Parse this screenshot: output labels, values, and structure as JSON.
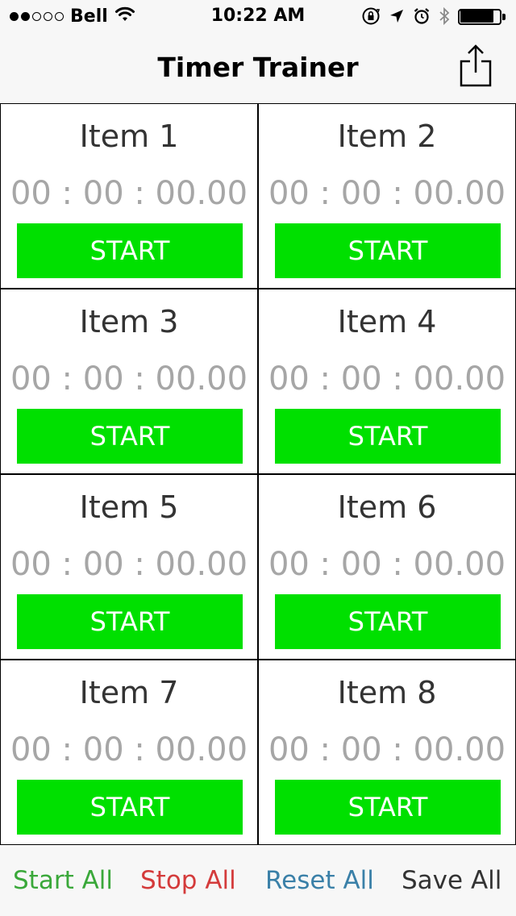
{
  "status_bar": {
    "carrier": "Bell",
    "time": "10:22 AM",
    "signal_bars_filled": 2,
    "signal_bars_total": 5,
    "battery_level_fraction": 0.85,
    "icons": [
      "wifi-icon",
      "rotation-lock-icon",
      "location-arrow-icon",
      "alarm-icon",
      "bluetooth-icon",
      "battery-icon"
    ]
  },
  "nav": {
    "title": "Timer Trainer",
    "share_icon": "share-icon"
  },
  "items": [
    {
      "title": "Item 1",
      "time": "00 : 00 : 00.00",
      "button": "START"
    },
    {
      "title": "Item 2",
      "time": "00 : 00 : 00.00",
      "button": "START"
    },
    {
      "title": "Item 3",
      "time": "00 : 00 : 00.00",
      "button": "START"
    },
    {
      "title": "Item 4",
      "time": "00 : 00 : 00.00",
      "button": "START"
    },
    {
      "title": "Item 5",
      "time": "00 : 00 : 00.00",
      "button": "START"
    },
    {
      "title": "Item 6",
      "time": "00 : 00 : 00.00",
      "button": "START"
    },
    {
      "title": "Item 7",
      "time": "00 : 00 : 00.00",
      "button": "START"
    },
    {
      "title": "Item 8",
      "time": "00 : 00 : 00.00",
      "button": "START"
    }
  ],
  "toolbar": {
    "start_all": "Start All",
    "stop_all": "Stop All",
    "reset_all": "Reset All",
    "save_all": "Save All"
  },
  "colors": {
    "start_button": "#00e000",
    "start_all": "#3aa83a",
    "stop_all": "#d43b3b",
    "reset_all": "#3a80a8",
    "save_all": "#333333",
    "time_text": "#a6a6a6",
    "item_title": "#333333"
  }
}
